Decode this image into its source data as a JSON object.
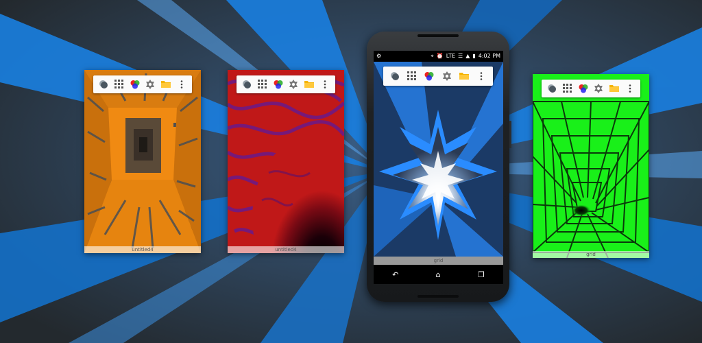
{
  "colors": {
    "bg_blue": "#1a7fe0",
    "bg_dark": "#2a3036",
    "maze_orange": "#f08a12",
    "maze_gray": "#4b4f52",
    "fluid_red": "#c01818",
    "fluid_purple": "#6a1a8a",
    "star_blue": "#2a8cff",
    "grid_green": "#19f019"
  },
  "toolbar_icons": [
    "layers-icon",
    "grid-icon",
    "color-circles-icon",
    "settings-icon",
    "folder-icon",
    "more-vert-icon"
  ],
  "cards": [
    {
      "caption": "untitled4",
      "theme": "maze"
    },
    {
      "caption": "untitled4",
      "theme": "fluid-tunnel"
    },
    {
      "caption": "grid",
      "theme": "green-grid-tunnel"
    }
  ],
  "phone": {
    "status": {
      "left_icon": "debug-icon",
      "network": "LTE",
      "time": "4:02",
      "ampm": "PM"
    },
    "caption": "grid",
    "nav": [
      "back-icon",
      "home-icon",
      "recents-icon"
    ]
  }
}
